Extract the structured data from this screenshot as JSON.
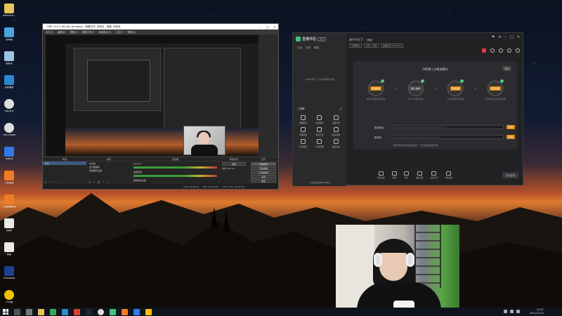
{
  "desktop": {
    "icons": [
      {
        "label": "Administr...",
        "icon": "user-folder-icon",
        "color": "#e8c25a"
      },
      {
        "label": "此电脑",
        "icon": "computer-icon",
        "color": "#4aa3df"
      },
      {
        "label": "回收站",
        "icon": "recycle-bin-icon",
        "color": "#9cc3e0"
      },
      {
        "label": "控制面板",
        "icon": "control-panel-icon",
        "color": "#2e88d0"
      },
      {
        "label": "OBS多开",
        "icon": "obs-icon",
        "color": "#ddd"
      },
      {
        "label": "OBS Studio",
        "icon": "obs-studio-icon",
        "color": "#ddd"
      },
      {
        "label": "ToDesk",
        "icon": "todesk-icon",
        "color": "#2f7be8"
      },
      {
        "label": "斗鱼直播",
        "icon": "douyu-icon",
        "color": "#f07c25"
      },
      {
        "label": "斗鱼直播伴侣",
        "icon": "douyu-companion-icon",
        "color": "#f07c25"
      },
      {
        "label": "page",
        "icon": "document-icon",
        "color": "#e9e9e9"
      },
      {
        "label": "新建",
        "icon": "new-file-icon",
        "color": "#e9e9e9"
      },
      {
        "label": "Photoshop",
        "icon": "photoshop-icon",
        "color": "#1f3f8f"
      },
      {
        "label": "YY开播",
        "icon": "yy-icon",
        "color": "#f2c200"
      }
    ]
  },
  "obs": {
    "title": "OBS 23.0.0 (64-bit, windows) - 配置文件: 未命名 - 场景: 未命名",
    "menu": [
      "文件(F)",
      "编辑(E)",
      "视图(V)",
      "配置文件(P)",
      "场景集合(S)",
      "工具(T)",
      "帮助(H)"
    ],
    "docks": {
      "scenes_title": "场景",
      "scenes": [
        "场景"
      ],
      "sources_title": "来源",
      "sources": [
        "文本层",
        "显示器捕获",
        "视频捕获设备"
      ],
      "mixer_title": "混音器",
      "mixer": [
        "mic/Aux",
        "桌面音频",
        "视频捕获设备"
      ],
      "transitions_title": "转场特效",
      "transition_value": "渐变",
      "duration_label": "时长",
      "duration_value": "300 ms",
      "controls_title": "控件",
      "controls": [
        "开始推流",
        "开始录制",
        "工作室模式",
        "设置",
        "退出"
      ]
    },
    "status": [
      "LIVE: 00:00:00",
      "REC: 00:00:00",
      "CPU: 5.5%, 30.00 fps"
    ]
  },
  "assistant": {
    "name": "直播伴侣",
    "badge": "测试",
    "tabs": [
      "互动",
      "礼物",
      "弹幕"
    ],
    "note": "OBS推流中，无法使用弹幕功能",
    "room_title": "孩子不大了",
    "room_tag": "修改",
    "room_meta": [
      "华南聊天",
      "分区：未选",
      "直播间号 7654321"
    ],
    "panel_title": "OBS第三方推流模式",
    "panel_exit": "退出",
    "steps": [
      {
        "num": "1",
        "label": "复制推流",
        "desc": "复制OBS推流码和地址"
      },
      {
        "num": "2",
        "label": "填入 OBS",
        "desc": "填入OBS推流设置"
      },
      {
        "num": "3",
        "label": "开始直播",
        "desc": "打开直播间开始直播"
      },
      {
        "num": "4",
        "label": "结束直播",
        "desc": "关闭OBS后点击结束直播"
      }
    ],
    "fields": [
      {
        "label": "推流地址",
        "value": "••••••••••••••••••••••••••••••••••••••••••",
        "button": "复制"
      },
      {
        "label": "推流码",
        "value": "••••••••••••••••••••••••••••••••••••",
        "button": "复制"
      }
    ],
    "tip": "*推流码仅限本场直播使用，下次直播需重新获取",
    "scene_header": "工具箱",
    "tools": [
      "弹幕助手",
      "房管助手",
      "主播日志",
      "录屏助手",
      "投票工具",
      "连麦功能",
      "音乐插件",
      "房间管理",
      "多屏互动"
    ],
    "footer": "PC主播请使用OBS推流",
    "bottom_tools": [
      "画面设置",
      "截图",
      "录屏",
      "美颜设置",
      "虚拟背景",
      "直播设置"
    ],
    "start_button": "结束直播"
  },
  "taskbar": {
    "time": "14:07",
    "date": "2021/11/12"
  }
}
